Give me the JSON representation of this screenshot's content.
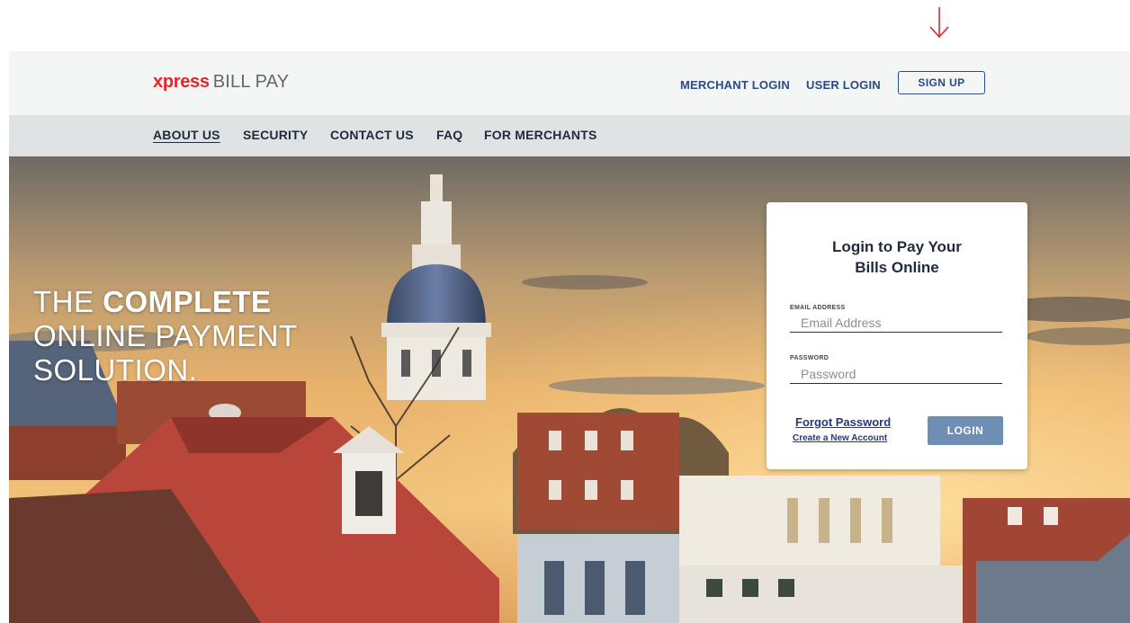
{
  "header": {
    "logo_brand": "xpress",
    "logo_rest": "BILL PAY",
    "merchant_login": "MERCHANT LOGIN",
    "user_login": "USER LOGIN",
    "sign_up": "SIGN UP"
  },
  "nav": {
    "items": [
      {
        "label": "ABOUT US"
      },
      {
        "label": "SECURITY"
      },
      {
        "label": "CONTACT US"
      },
      {
        "label": "FAQ"
      },
      {
        "label": "FOR MERCHANTS"
      }
    ]
  },
  "hero": {
    "line1_prefix": "THE",
    "line1_strong": "COMPLETE",
    "line2": "ONLINE PAYMENT",
    "line3": "SOLUTION."
  },
  "login": {
    "title_line1": "Login to Pay Your",
    "title_line2": "Bills Online",
    "email_label": "EMAIL ADDRESS",
    "email_placeholder": "Email Address",
    "password_label": "PASSWORD",
    "password_placeholder": "Password",
    "forgot": "Forgot Password",
    "create": "Create a New Account",
    "login_button": "LOGIN"
  },
  "colors": {
    "brand_red": "#e3262c",
    "link_blue": "#2a4b85",
    "login_button": "#6e8fb3"
  },
  "icons": {
    "annotation": "arrow-down-icon"
  }
}
